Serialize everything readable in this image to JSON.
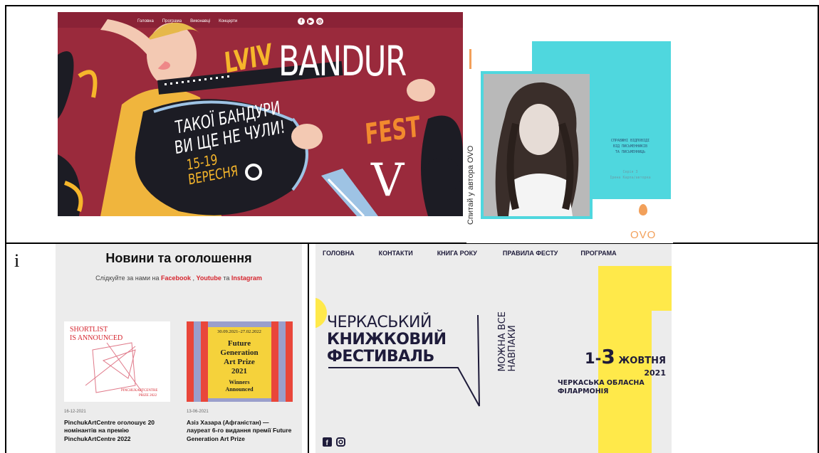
{
  "bandur": {
    "nav": [
      "Головна",
      "Програма",
      "Виконавці",
      "Концерти"
    ],
    "social_icons": [
      "facebook-icon",
      "youtube-icon",
      "instagram-icon"
    ],
    "lviv": "LVIV",
    "title": "BANDUR",
    "fest": "FEST",
    "slogan_line1": "ТАКОЇ БАНДУРИ",
    "slogan_line2": "ВИ ЩЕ НЕ ЧУЛИ!",
    "dates": "15-19",
    "month": "ВЕРЕСНЯ",
    "edition": "V",
    "colors": {
      "bg": "#9a2a3c",
      "gold": "#f6b62b",
      "orange": "#f28a2e"
    }
  },
  "ovo": {
    "vertical_text": "Спитай у автора OVO",
    "tagline_line1": "СПРАВЖНІ ВІДПОВІДІ",
    "tagline_line2": "ВІД ПИСЬМЕННИКІВ",
    "tagline_line3": "ТА ПИСЬМЕННИЦЬ",
    "episode": "Серія 3",
    "author": "Ірена Карпа/авторка",
    "logo": "OVO",
    "colors": {
      "cyan": "#4fd7de",
      "egg": "#f2a05a"
    }
  },
  "cell_label": "i",
  "news": {
    "title": "Новини та оголошення",
    "follow_prefix": "Слідкуйте за нами на",
    "facebook": "Facebook",
    "sep1": " , ",
    "youtube": "Youtube",
    "sep2": " та ",
    "instagram": "Instagram",
    "cards": [
      {
        "img_line1": "SHORTLIST",
        "img_line2": "IS ANNOUNCED",
        "img_brand1": "PINCHUKARTCENTRE",
        "img_brand2": "PRIZE 2022",
        "date": "16-12-2021",
        "title": "PinchukArtCentre оголошує 20 номінантів на премію PinchukArtCentre 2022"
      },
      {
        "img_dates": "30.09.2021–27.02.2022",
        "img_line1": "Future",
        "img_line2": "Generation",
        "img_line3": "Art Prize",
        "img_line4": "2021",
        "img_line5": "Winners",
        "img_line6": "Announced",
        "date": "13-06-2021",
        "title": "Азіз Хазара (Афганістан) — лауреат 6-го видання премії Future Generation Art Prize"
      }
    ],
    "colors": {
      "link": "#d6262f",
      "bg": "#ececec"
    }
  },
  "cbf": {
    "nav": [
      "ГОЛОВНА",
      "КОНТАКТИ",
      "КНИГА РОКУ",
      "ПРАВИЛА ФЕСТУ",
      "ПРОГРАМА"
    ],
    "title_line1": "ЧЕРКАСЬКИЙ",
    "title_line2": "КНИЖКОВИЙ",
    "title_line3": "ФЕСТИВАЛЬ",
    "slogan_line1": "МОЖНА ВСЕ",
    "slogan_line2": "НАВПАКИ",
    "date_from": "1-",
    "date_to": "3",
    "month": " ЖОВТНЯ",
    "year": "2021",
    "venue": "ЧЕРКАСЬКА ОБЛАСНА ФІЛАРМОНІЯ",
    "social_icons": [
      "facebook-icon",
      "instagram-icon"
    ],
    "colors": {
      "yellow": "#ffe94a",
      "navy": "#1e1b3a"
    }
  }
}
